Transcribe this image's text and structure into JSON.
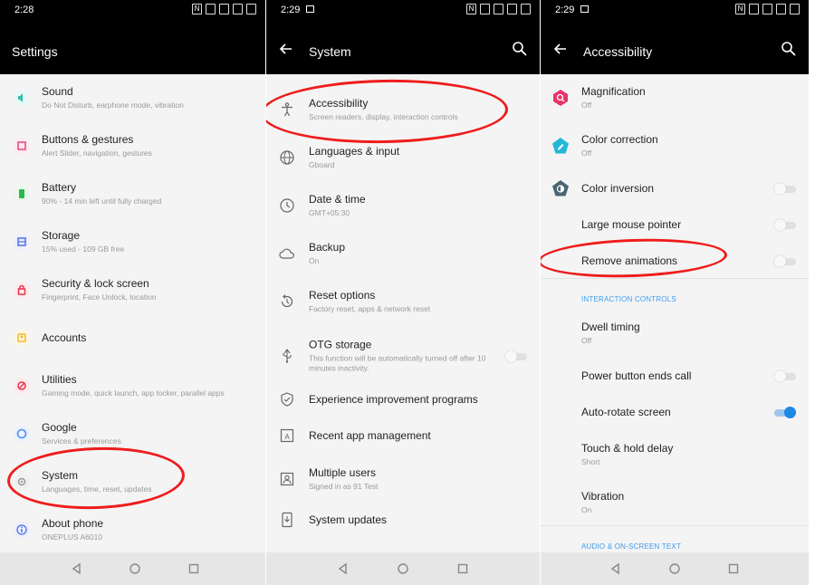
{
  "panel1": {
    "time": "2:28",
    "title": "Settings",
    "items": [
      {
        "title": "Sound",
        "subtitle": "Do Not Disturb, earphone mode, vibration",
        "icon": "speaker-icon",
        "color": "#35bfa9"
      },
      {
        "title": "Buttons & gestures",
        "subtitle": "Alert Slider, navigation, gestures",
        "icon": "buttons-icon",
        "color": "#e8457a"
      },
      {
        "title": "Battery",
        "subtitle": "90% - 14 min left until fully charged",
        "icon": "battery-icon",
        "color": "#2fb84a"
      },
      {
        "title": "Storage",
        "subtitle": "15% used - 109 GB free",
        "icon": "storage-icon",
        "color": "#4f6ee8"
      },
      {
        "title": "Security & lock screen",
        "subtitle": "Fingerprint, Face Unlock, location",
        "icon": "lock-icon",
        "color": "#e8344a"
      },
      {
        "title": "Accounts",
        "subtitle": "",
        "icon": "accounts-icon",
        "color": "#f0b92b"
      },
      {
        "title": "Utilities",
        "subtitle": "Gaming mode, quick launch, app locker, parallel apps",
        "icon": "utilities-icon",
        "color": "#e8344a"
      },
      {
        "title": "Google",
        "subtitle": "Services & preferences",
        "icon": "google-icon",
        "color": "#4f8ff0"
      },
      {
        "title": "System",
        "subtitle": "Languages, time, reset, updates",
        "icon": "gear-icon",
        "color": "#9a9a9a"
      },
      {
        "title": "About phone",
        "subtitle": "ONEPLUS A6010",
        "icon": "info-icon",
        "color": "#4f6ee8"
      }
    ]
  },
  "panel2": {
    "time": "2:29",
    "title": "System",
    "items": [
      {
        "title": "Accessibility",
        "subtitle": "Screen readers, display, interaction controls",
        "icon": "accessibility-icon"
      },
      {
        "title": "Languages & input",
        "subtitle": "Gboard",
        "icon": "globe-icon"
      },
      {
        "title": "Date & time",
        "subtitle": "GMT+05:30",
        "icon": "clock-icon"
      },
      {
        "title": "Backup",
        "subtitle": "On",
        "icon": "cloud-icon"
      },
      {
        "title": "Reset options",
        "subtitle": "Factory reset, apps & network reset",
        "icon": "reset-icon"
      },
      {
        "title": "OTG storage",
        "subtitle": "This function will be automatically turned off after 10 minutes inactivity.",
        "icon": "usb-icon",
        "toggle": "off"
      },
      {
        "title": "Experience improvement programs",
        "subtitle": "",
        "icon": "shield-check-icon"
      },
      {
        "title": "Recent app management",
        "subtitle": "",
        "icon": "recent-apps-icon"
      },
      {
        "title": "Multiple users",
        "subtitle": "Signed in as 91 Test",
        "icon": "user-icon"
      },
      {
        "title": "System updates",
        "subtitle": "",
        "icon": "system-update-icon"
      }
    ]
  },
  "panel3": {
    "time": "2:29",
    "title": "Accessibility",
    "items": [
      {
        "title": "Magnification",
        "subtitle": "Off",
        "icon": "magnification-icon",
        "color": "#e8346a"
      },
      {
        "title": "Color correction",
        "subtitle": "Off",
        "icon": "color-correction-icon",
        "color": "#22b8d8"
      },
      {
        "title": "Color inversion",
        "subtitle": "",
        "icon": "color-inversion-icon",
        "color": "#4a6474",
        "toggle": "off"
      },
      {
        "title": "Large mouse pointer",
        "subtitle": "",
        "icon": "",
        "toggle": "off"
      },
      {
        "title": "Remove animations",
        "subtitle": "",
        "icon": "",
        "toggle": "off"
      },
      {
        "title": "Dwell timing",
        "subtitle": "Off",
        "icon": ""
      },
      {
        "title": "Power button ends call",
        "subtitle": "",
        "icon": "",
        "toggle": "off"
      },
      {
        "title": "Auto-rotate screen",
        "subtitle": "",
        "icon": "",
        "toggle": "on"
      },
      {
        "title": "Touch & hold delay",
        "subtitle": "Short",
        "icon": ""
      },
      {
        "title": "Vibration",
        "subtitle": "On",
        "icon": ""
      }
    ],
    "sections": [
      "INTERACTION CONTROLS",
      "AUDIO & ON-SCREEN TEXT"
    ]
  },
  "colors": {
    "highlight": "#ef1c1c",
    "accent": "#1e88e5",
    "section": "#3b9cf0"
  }
}
